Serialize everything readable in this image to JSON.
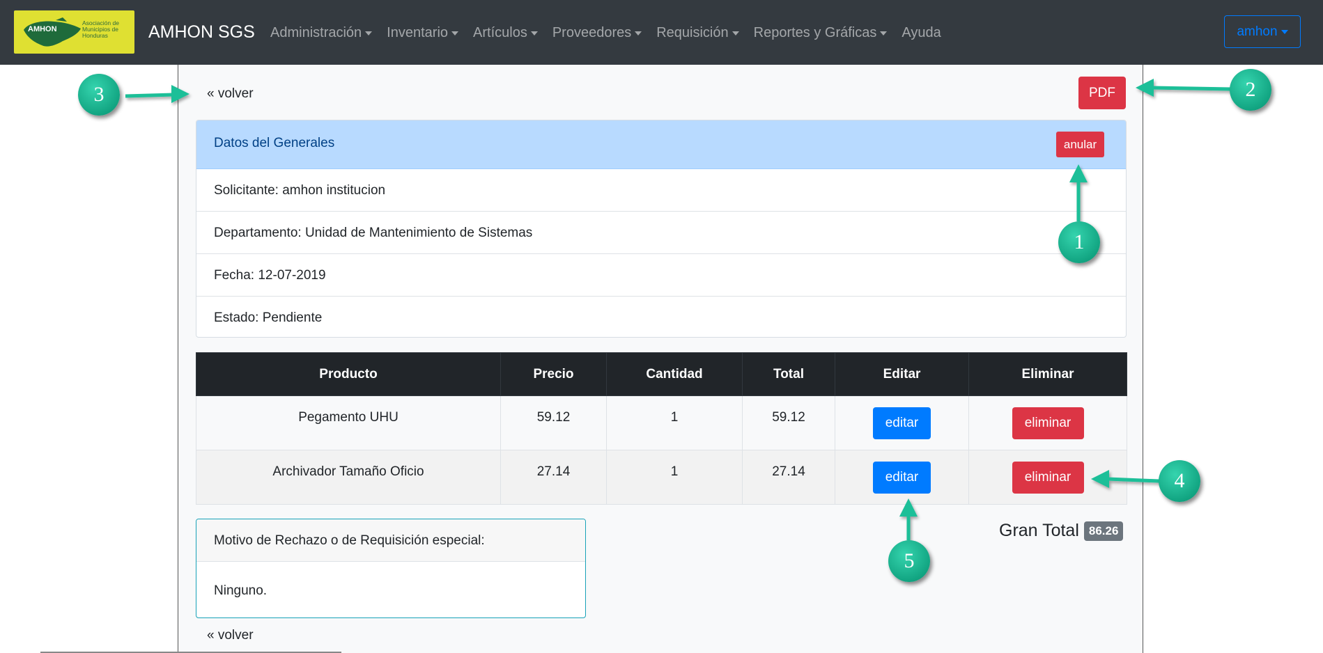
{
  "navbar": {
    "logo_name": "AMHON",
    "logo_caption": "Asociación de Municipios de Honduras",
    "brand": "AMHON SGS",
    "menu": [
      {
        "label": "Administración",
        "dropdown": true
      },
      {
        "label": "Inventario",
        "dropdown": true
      },
      {
        "label": "Artículos",
        "dropdown": true
      },
      {
        "label": "Proveedores",
        "dropdown": true
      },
      {
        "label": "Requisición",
        "dropdown": true
      },
      {
        "label": "Reportes y Gráficas",
        "dropdown": true
      },
      {
        "label": "Ayuda",
        "dropdown": false
      }
    ],
    "user": "amhon"
  },
  "page": {
    "back_label": "« volver",
    "pdf_label": "PDF"
  },
  "general": {
    "header": "Datos del Generales",
    "anular_label": "anular",
    "solicitante": "Solicitante: amhon institucion",
    "departamento": "Departamento: Unidad de Mantenimiento de Sistemas",
    "fecha": "Fecha: 12-07-2019",
    "estado": "Estado: Pendiente"
  },
  "table": {
    "headers": [
      "Producto",
      "Precio",
      "Cantidad",
      "Total",
      "Editar",
      "Eliminar"
    ],
    "rows": [
      {
        "producto": "Pegamento UHU",
        "precio": "59.12",
        "cantidad": "1",
        "total": "59.12",
        "edit_label": "editar",
        "delete_label": "eliminar"
      },
      {
        "producto": "Archivador Tamaño Oficio",
        "precio": "27.14",
        "cantidad": "1",
        "total": "27.14",
        "edit_label": "editar",
        "delete_label": "eliminar"
      }
    ]
  },
  "summary": {
    "gran_total_label": "Gran Total",
    "gran_total_value": "86.26"
  },
  "motivo": {
    "header": "Motivo de Rechazo o de Requisición especial:",
    "body": "Ninguno."
  },
  "annotations": [
    "1",
    "2",
    "3",
    "4",
    "5"
  ],
  "colors": {
    "navbar": "#343a40",
    "primary": "#007bff",
    "danger": "#dc3545",
    "header_info": "#b8daff",
    "callout": "#1bbf98"
  }
}
